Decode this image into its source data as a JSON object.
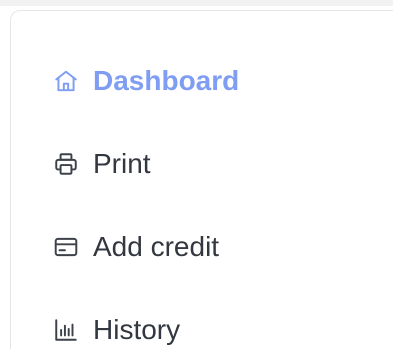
{
  "colors": {
    "active": "#7f9df2",
    "text": "#333840",
    "icon": "#3d424a"
  },
  "sidebar": {
    "items": [
      {
        "label": "Dashboard",
        "icon": "home-icon",
        "active": true
      },
      {
        "label": "Print",
        "icon": "printer-icon",
        "active": false
      },
      {
        "label": "Add credit",
        "icon": "credit-card-icon",
        "active": false
      },
      {
        "label": "History",
        "icon": "bar-chart-icon",
        "active": false
      }
    ]
  }
}
